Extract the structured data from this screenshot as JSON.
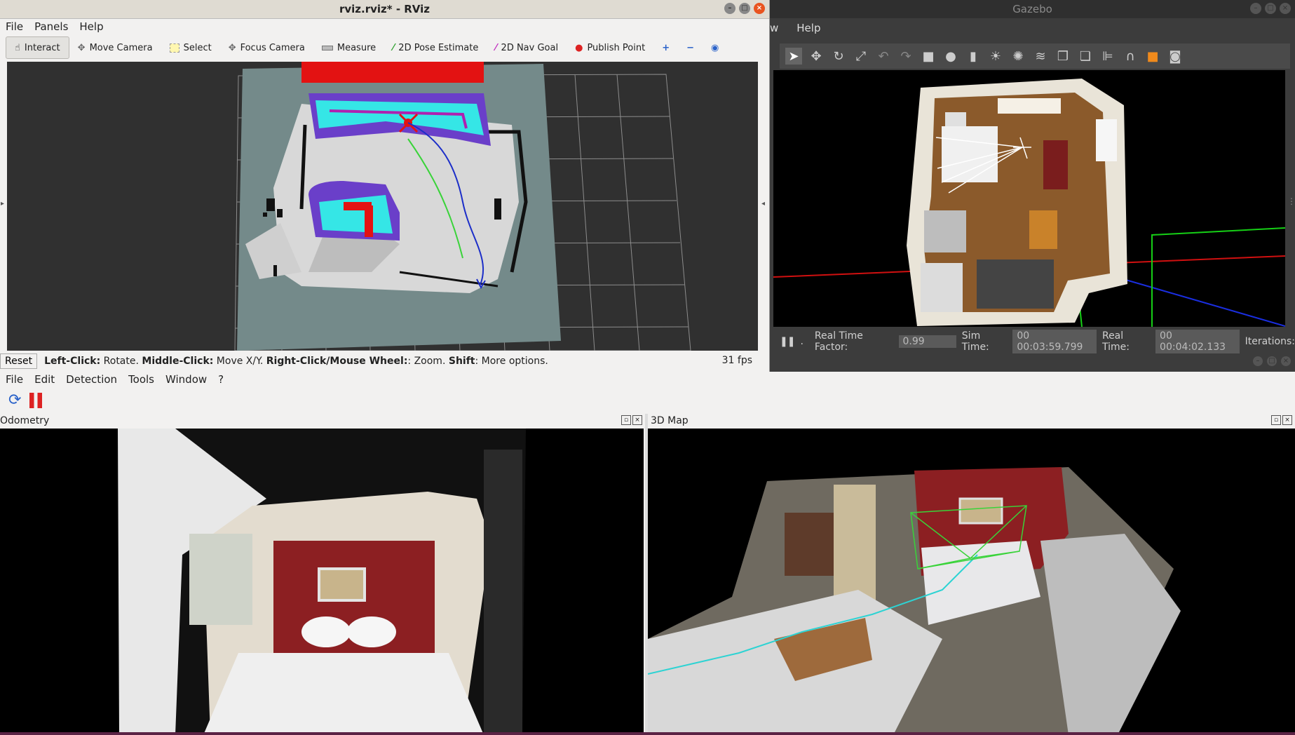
{
  "rviz": {
    "window_title": "rviz.rviz* - RViz",
    "menu": [
      "File",
      "Panels",
      "Help"
    ],
    "tools": [
      {
        "label": "Interact",
        "icon": "hand-pointer-icon"
      },
      {
        "label": "Move Camera",
        "icon": "move-camera-icon"
      },
      {
        "label": "Select",
        "icon": "select-box-icon"
      },
      {
        "label": "Focus Camera",
        "icon": "focus-camera-icon"
      },
      {
        "label": "Measure",
        "icon": "ruler-icon"
      },
      {
        "label": "2D Pose Estimate",
        "icon": "pose-arrow-icon"
      },
      {
        "label": "2D Nav Goal",
        "icon": "goal-arrow-icon"
      },
      {
        "label": "Publish Point",
        "icon": "map-pin-icon"
      }
    ],
    "reset_label": "Reset",
    "status": {
      "left_click": "Left-Click:",
      "left_action": " Rotate. ",
      "middle_click": "Middle-Click:",
      "middle_action": " Move X/Y. ",
      "right_click": "Right-Click/Mouse Wheel:",
      "right_action": ": Zoom. ",
      "shift": "Shift",
      "shift_action": ": More options."
    },
    "fps": "31 fps"
  },
  "gazebo": {
    "window_title": "Gazebo",
    "menu_partial": "w",
    "menu_help": "Help",
    "status": {
      "rtf_label": "Real Time Factor:",
      "rtf_value": "0.99",
      "sim_label": "Sim Time:",
      "sim_value": "00 00:03:59.799",
      "real_label": "Real Time:",
      "real_value": "00 00:04:02.133",
      "iter_label": "Iterations:"
    }
  },
  "rtabmap": {
    "menu": [
      "File",
      "Edit",
      "Detection",
      "Tools",
      "Window",
      "?"
    ],
    "panel_odometry": "Odometry",
    "panel_map": "3D Map"
  }
}
